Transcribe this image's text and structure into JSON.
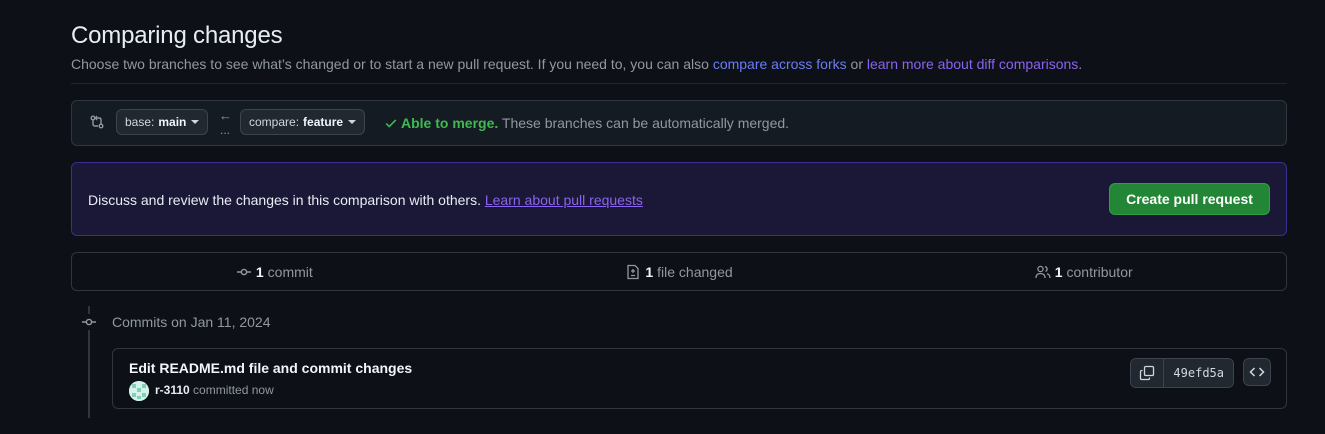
{
  "header": {
    "title": "Comparing changes",
    "desc_prefix": "Choose two branches to see what’s changed or to start a new pull request. If you need to, you can also ",
    "link_forks": "compare across forks",
    "desc_mid": " or ",
    "link_diff": "learn more about diff comparisons",
    "desc_suffix": "."
  },
  "range": {
    "base_prefix": "base:",
    "base_branch": "main",
    "compare_prefix": "compare:",
    "compare_branch": "feature",
    "arrow": "←",
    "dots": "...",
    "merge_ok": "Able to merge.",
    "merge_msg": "These branches can be automatically merged."
  },
  "promo": {
    "text": "Discuss and review the changes in this comparison with others.",
    "link": "Learn about pull requests",
    "button": "Create pull request"
  },
  "stats": {
    "commits_count": "1",
    "commits_label": "commit",
    "files_count": "1",
    "files_label": "file changed",
    "contributors_count": "1",
    "contributors_label": "contributor"
  },
  "commits": {
    "date_label": "Commits on Jan 11, 2024",
    "items": [
      {
        "title": "Edit README.md file and commit changes",
        "author": "r-3110",
        "time": "committed now",
        "sha": "49efd5a"
      }
    ]
  },
  "colors": {
    "accent_green": "#238636",
    "merge_ok": "#3fb950",
    "link": "#8a63f0",
    "background": "#0d1117"
  },
  "icons": [
    "git-compare-icon",
    "check-icon",
    "git-commit-icon",
    "file-diff-icon",
    "people-icon",
    "copy-icon",
    "code-icon",
    "caret-down-icon"
  ]
}
